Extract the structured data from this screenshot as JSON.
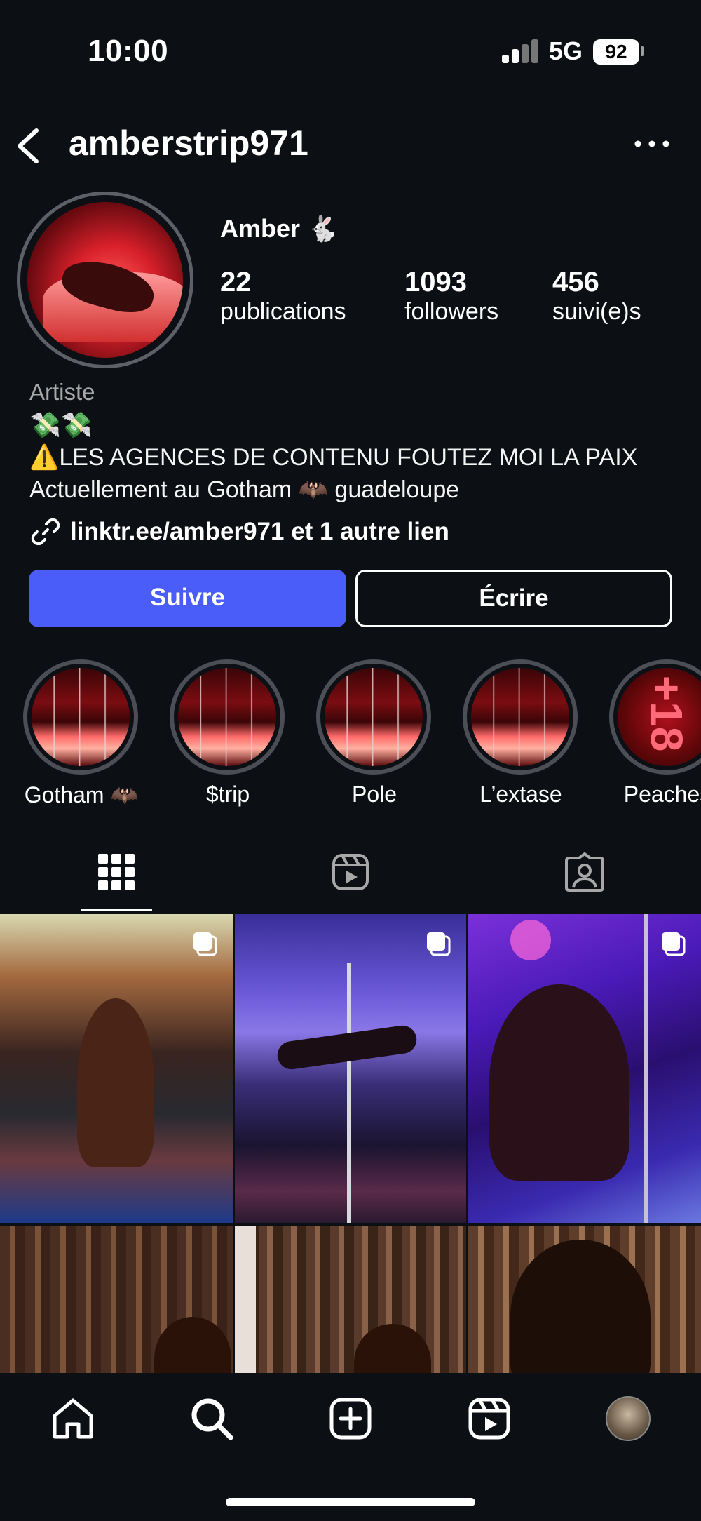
{
  "status_bar": {
    "time": "10:00",
    "network": "5G",
    "battery": "92"
  },
  "header": {
    "username": "amberstrip971"
  },
  "profile": {
    "display_name": "Amber 🐇",
    "stats": [
      {
        "value": "22",
        "label": "publications"
      },
      {
        "value": "1093",
        "label": "followers"
      },
      {
        "value": "456",
        "label": "suivi(e)s"
      }
    ],
    "category": "Artiste",
    "bio_emoji": "💸💸",
    "bio_lines": [
      "⚠️LES AGENCES DE CONTENU FOUTEZ MOI LA PAIX",
      "Actuellement au Gotham 🦇 guadeloupe"
    ],
    "link": "linktr.ee/amber971 et 1 autre lien"
  },
  "actions": {
    "follow": "Suivre",
    "message": "Écrire"
  },
  "highlights": [
    {
      "label": "Gotham 🦇"
    },
    {
      "label": "$trip"
    },
    {
      "label": "Pole"
    },
    {
      "label": "L’extase"
    },
    {
      "label": "Peaches",
      "badge": "+18"
    }
  ],
  "tabs": [
    "grid-icon",
    "reels-icon",
    "tagged-icon"
  ],
  "nav": [
    "home-icon",
    "search-icon",
    "create-icon",
    "reels-icon",
    "profile-avatar"
  ],
  "colors": {
    "background": "#0c1014",
    "follow_button": "#4a5df9",
    "secondary_text": "#a8a8a8"
  }
}
